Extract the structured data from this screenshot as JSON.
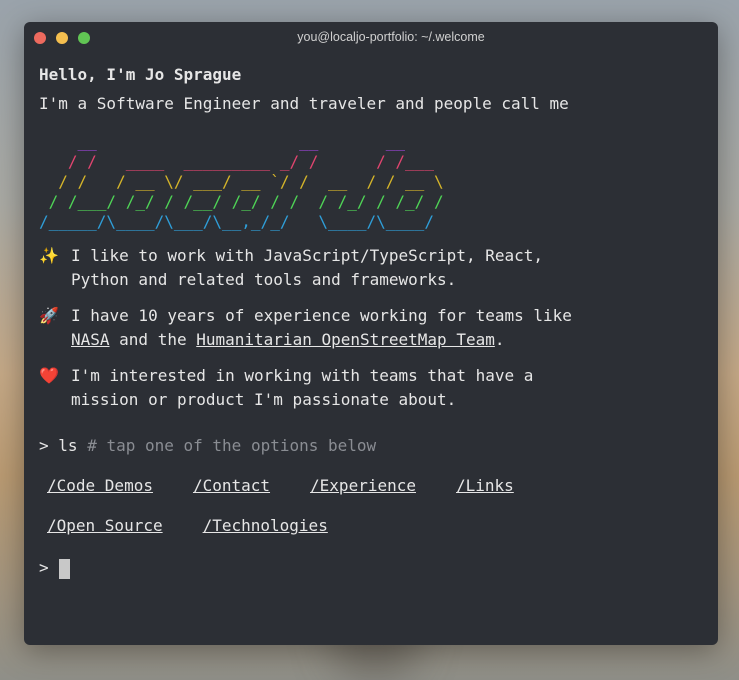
{
  "window": {
    "title": "you@localjo-portfolio: ~/.welcome",
    "controls": {
      "close": "#ed6a5e",
      "minimize": "#f5bf4f",
      "maximize": "#61c554"
    }
  },
  "greeting": "Hello, I'm Jo Sprague",
  "intro": "I'm a Software Engineer and traveler and people call me",
  "logo": {
    "text": "Local Jo",
    "lines": [
      "    __                     __       __    ",
      "   / /   ____  _________ _/ /      / /___ ",
      "  / /   / __ \\/ ___/ __ `/ /  __  / / __ \\",
      " / /___/ /_/ / /__/ /_/ / /  / /_/ / /_/ /",
      "/_____/\\____/\\___/\\__,_/_/   \\____/\\____/ "
    ],
    "colors": [
      "#9b45d6",
      "#e0456f",
      "#d4b42a",
      "#4fd456",
      "#2f9ed8"
    ]
  },
  "paragraphs": [
    {
      "icon": "sparkles-icon",
      "emoji": "✨",
      "text1": "I like to work with JavaScript/TypeScript, React,",
      "text2": "Python and related tools and frameworks."
    },
    {
      "icon": "rocket-icon",
      "emoji": "🚀",
      "text1": "I have 10 years of experience working for teams like",
      "link1": "NASA",
      "mid": " and the ",
      "link2": "Humanitarian OpenStreetMap Team",
      "end": "."
    },
    {
      "icon": "heart-icon",
      "emoji": "❤️",
      "text1": "I'm interested in working with teams that have a",
      "text2": "mission or product I'm passionate about."
    }
  ],
  "command": {
    "prompt": ">",
    "cmd": "ls",
    "comment": "# tap one of the options below"
  },
  "options": [
    "/Code Demos",
    "/Contact",
    "/Experience",
    "/Links",
    "/Open Source",
    "/Technologies"
  ],
  "input_prompt": ">"
}
